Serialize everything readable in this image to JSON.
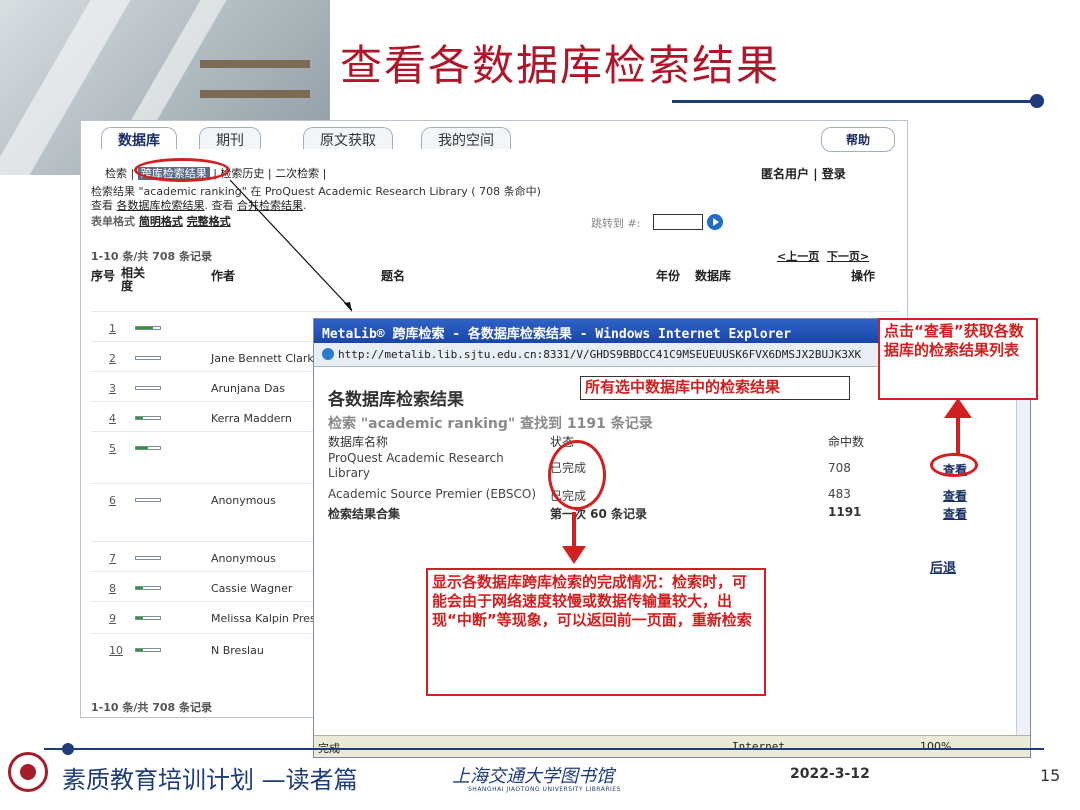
{
  "slide": {
    "title": "查看各数据库检索结果",
    "footer_text": "素质教育培训计划 —读者篇",
    "library_name": "上海交通大学图书馆",
    "library_name_en": "SHANGHAI JIAOTONG UNIVERSITY LIBRARIES",
    "date": "2022-3-12",
    "page_number": "15"
  },
  "main_page": {
    "tabs": [
      "数据库",
      "期刊",
      "原文获取",
      "我的空间"
    ],
    "help": "帮助",
    "subnav": {
      "item1": "检索",
      "item2": "跨库检索结果",
      "item3": "检索历史",
      "item4": "二次检索"
    },
    "anon_user": "匿名用户",
    "login": "登录",
    "search_desc": "检索结果 \"academic ranking\" 在 ProQuest Academic Research Library ( 708 条命中)",
    "view_prefix": "查看",
    "view_link1": "各数据库检索结果",
    "view_link2": "合并检索结果",
    "format_label": "表单格式",
    "format_brief": "简明格式",
    "format_full": "完整格式",
    "jump_label": "跳转到 #:",
    "records_top": "1-10 条/共 708 条记录",
    "prev": "<上一页",
    "next": "下一页>",
    "columns": {
      "idx": "序号",
      "relevance": "相关度",
      "author": "作者",
      "title": "题名",
      "year": "年份",
      "database": "数据库",
      "action": "操作"
    },
    "rows": [
      {
        "idx": "1",
        "author": "",
        "relevance": 0.7
      },
      {
        "idx": "2",
        "author": "Jane Bennett Clark",
        "relevance": 0
      },
      {
        "idx": "3",
        "author": "Arunjana Das",
        "relevance": 0
      },
      {
        "idx": "4",
        "author": "Kerra Maddern",
        "relevance": 0.3
      },
      {
        "idx": "5",
        "author": "",
        "relevance": 0.5
      },
      {
        "idx": "6",
        "author": "Anonymous",
        "relevance": 0
      },
      {
        "idx": "7",
        "author": "Anonymous",
        "relevance": 0
      },
      {
        "idx": "8",
        "author": "Cassie Wagner",
        "relevance": 0.3
      },
      {
        "idx": "9",
        "author": "Melissa Kalpin Prescott",
        "relevance": 0.3
      },
      {
        "idx": "10",
        "author": "N Breslau",
        "relevance": 0.3
      }
    ],
    "records_bottom": "1-10 条/共 708 条记录"
  },
  "popup": {
    "title": "MetaLib® 跨库检索 - 各数据库检索结果 - Windows Internet Explorer",
    "url": "http://metalib.lib.sjtu.edu.cn:8331/V/GHDS9BBDCC41C9MSEUEUUSK6FVX6DMSJX2BUJK3XK",
    "heading": "各数据库检索结果",
    "query": "检索 \"academic ranking\" 查找到 1191 条记录",
    "col_name": "数据库名称",
    "col_status": "状态",
    "col_hits": "命中数",
    "results": [
      {
        "name": "ProQuest Academic Research Library",
        "status": "已完成",
        "hits": "708",
        "view": "查看"
      },
      {
        "name": "Academic Source Premier (EBSCO)",
        "status": "已完成",
        "hits": "483",
        "view": "查看"
      }
    ],
    "merged": {
      "name": "检索结果合集",
      "status": "第一次 60 条记录",
      "hits": "1191",
      "view": "查看"
    },
    "back": "后退",
    "status_done": "完成",
    "zone": "Internet",
    "zoom": "100%"
  },
  "annotations": {
    "all_selected": "所有选中数据库中的检索结果",
    "view_tip": "点击“查看”获取各数据库的检索结果列表",
    "status_tip": "显示各数据库跨库检索的完成情况：检索时，可能会由于网络速度较慢或数据传输量较大，出现“中断”等现象，可以返回前一页面，重新检索"
  },
  "colors": {
    "title_red": "#b0162a",
    "navy": "#1f3c7a",
    "callout_red": "#d21f1f",
    "ie_blue": "#2f63c7"
  }
}
